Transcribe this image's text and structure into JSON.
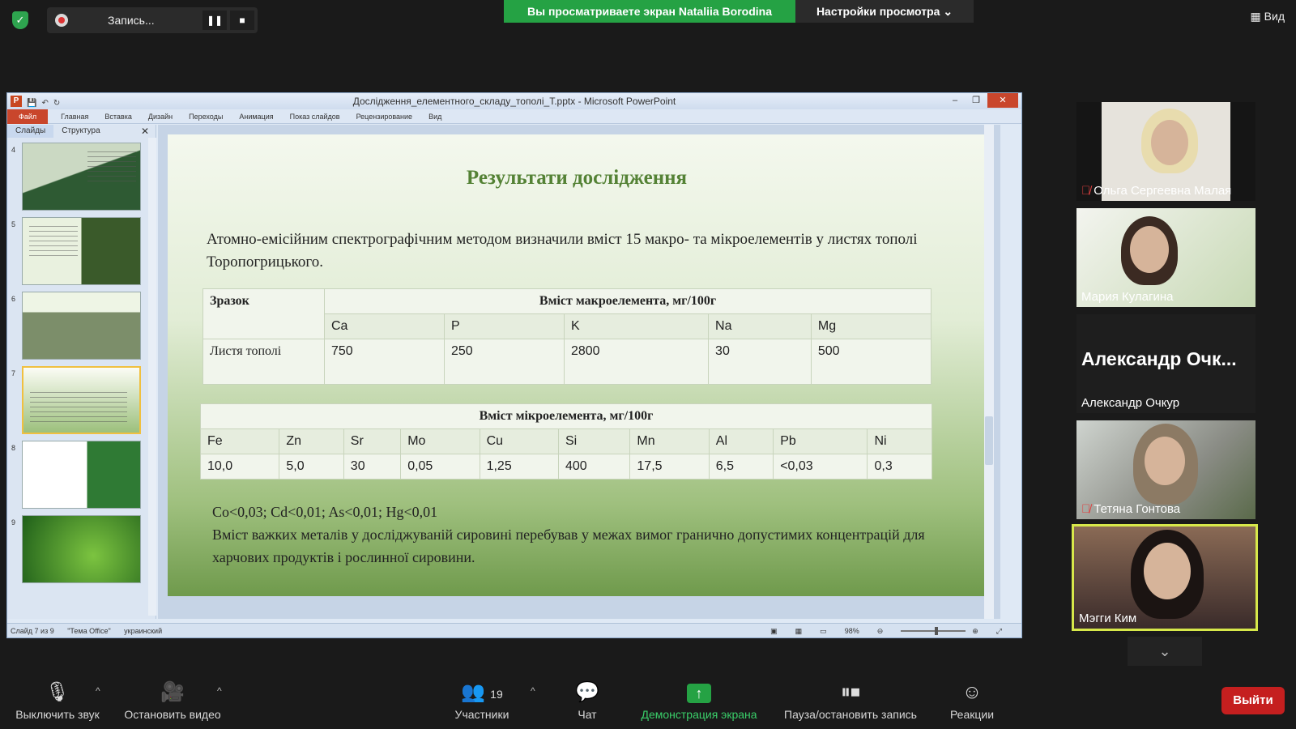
{
  "zoom_topbar": {
    "recording_label": "Запись...",
    "banner": "Вы просматриваете экран Nataliia Borodina",
    "view_options": "Настройки просмотра",
    "view_button": "Вид"
  },
  "ppt": {
    "window_title": "Дослідження_елементного_складу_тополі_T.pptx - Microsoft PowerPoint",
    "ribbon_tabs": [
      "Файл",
      "Главная",
      "Вставка",
      "Дизайн",
      "Переходы",
      "Анимация",
      "Показ слайдов",
      "Рецензирование",
      "Вид"
    ],
    "pane_tabs": [
      "Слайды",
      "Структура"
    ],
    "thumbnails": [
      {
        "num": "4",
        "style": "map"
      },
      {
        "num": "5",
        "style": "forest"
      },
      {
        "num": "6",
        "style": "leaves"
      },
      {
        "num": "7",
        "style": "table",
        "selected": true
      },
      {
        "num": "8",
        "style": "cert"
      },
      {
        "num": "9",
        "style": "leaf"
      }
    ],
    "status": {
      "slide": "Слайд 7 из 9",
      "theme": "\"Тема Office\"",
      "language": "украинский",
      "zoom": "98%"
    }
  },
  "slide": {
    "title": "Результати дослідження",
    "intro": "Атомно-емісійним спектрографічним методом визначили вміст 15 макро- та мікроелементів у листях тополі Торопогрицького.",
    "macro_table": {
      "sample_header": "Зразок",
      "content_header": "Вміст макроелемента, мг/100г",
      "elements": [
        "Ca",
        "P",
        "K",
        "Na",
        "Mg"
      ],
      "sample_name": "Листя тополі",
      "values": [
        "750",
        "250",
        "2800",
        "30",
        "500"
      ]
    },
    "micro_table": {
      "header": "Вміст мікроелемента, мг/100г",
      "elements": [
        "Fe",
        "Zn",
        "Sr",
        "Mo",
        "Cu",
        "Si",
        "Mn",
        "Al",
        "Pb",
        "Ni"
      ],
      "values": [
        "10,0",
        "5,0",
        "30",
        "0,05",
        "1,25",
        "400",
        "17,5",
        "6,5",
        "<0,03",
        "0,3"
      ]
    },
    "footnote_line1": "Co<0,03; Cd<0,01; As<0,01; Hg<0,01",
    "footnote_line2": "Вміст важких металів у досліджуваній сировині перебував у межах вимог гранично допустимих концентрацій для харчових продуктів і рослинної сировини."
  },
  "participants": [
    {
      "name": "Ольга Сергеевна Малая",
      "muted": true
    },
    {
      "name": "Мария Кулагина",
      "muted": false
    },
    {
      "name": "Александр Очкур",
      "display": "Александр Очк...",
      "muted": false
    },
    {
      "name": "Тетяна Гонтова",
      "muted": true
    },
    {
      "name": "Мэгги Ким",
      "muted": false,
      "active_speaker": true
    }
  ],
  "toolbar": {
    "mute": "Выключить звук",
    "video": "Остановить видео",
    "participants": "Участники",
    "participants_count": "19",
    "chat": "Чат",
    "share": "Демонстрация экрана",
    "record": "Пауза/остановить запись",
    "reactions": "Реакции",
    "leave": "Выйти"
  },
  "colors": {
    "banner_green": "#25a244",
    "leave_red": "#c51f1f",
    "slide_title_green": "#548235",
    "active_speaker_border": "#d7e84a"
  }
}
